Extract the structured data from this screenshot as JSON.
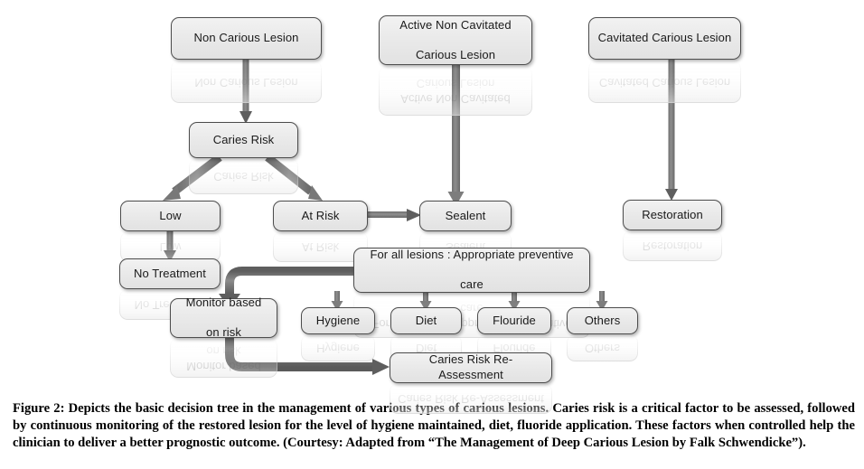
{
  "figure": {
    "caption": "Figure 2: Depicts the basic decision tree in the management of various types of carious lesions. Caries risk is a critical factor to be assessed, followed by continuous monitoring of the restored lesion for the level of hygiene maintained, diet, fluoride application. These factors when controlled help the clinician to deliver a better prognostic outcome. (Courtesy: Adapted from “The Management of Deep Carious Lesion by Falk Schwendicke”)."
  },
  "colors": {
    "box_fill_top": "#f2f2f2",
    "box_fill_bottom": "#e2e2e2",
    "box_border": "#4d4d4d",
    "text": "#1a1a1a",
    "arrow_dark": "#6b6b6b",
    "arrow_light": "#9a9a9a",
    "page_background": "#ffffff"
  },
  "nodes": {
    "non_carious_lesion": {
      "label": "Non Carious Lesion"
    },
    "active_non_cavitated": {
      "label": "Active Non Cavitated Carious Lesion",
      "line1": "Active Non Cavitated",
      "line2": "Carious Lesion"
    },
    "cavitated_carious": {
      "label": "Cavitated Carious Lesion"
    },
    "caries_risk": {
      "label": "Caries Risk"
    },
    "low": {
      "label": "Low"
    },
    "at_risk": {
      "label": "At Risk"
    },
    "sealent": {
      "label": "Sealent"
    },
    "restoration": {
      "label": "Restoration"
    },
    "no_treatment": {
      "label": "No Treatment"
    },
    "preventive_care": {
      "label": "For all lesions : Appropriate preventive care",
      "line1": "For all lesions : Appropriate preventive",
      "line2": "care"
    },
    "monitor_based_on_risk": {
      "label": "Monitor based on risk",
      "line1": "Monitor based",
      "line2": "on risk"
    },
    "hygiene": {
      "label": "Hygiene"
    },
    "diet": {
      "label": "Diet"
    },
    "flouride": {
      "label": "Flouride"
    },
    "others": {
      "label": "Others"
    },
    "caries_risk_reassessment": {
      "label": "Caries Risk Re-Assessment"
    }
  },
  "edges": [
    {
      "id": "e-noncarious-cariesrisk",
      "from": "non_carious_lesion",
      "to": "caries_risk",
      "style": "straight-down"
    },
    {
      "id": "e-cariesrisk-low",
      "from": "caries_risk",
      "to": "low",
      "style": "diagonal"
    },
    {
      "id": "e-cariesrisk-atrisk",
      "from": "caries_risk",
      "to": "at_risk",
      "style": "diagonal"
    },
    {
      "id": "e-atrisk-sealent",
      "from": "at_risk",
      "to": "sealent",
      "style": "straight-right"
    },
    {
      "id": "e-active-sealent",
      "from": "active_non_cavitated",
      "to": "sealent",
      "style": "straight-down"
    },
    {
      "id": "e-cavitated-restoration",
      "from": "cavitated_carious",
      "to": "restoration",
      "style": "straight-down"
    },
    {
      "id": "e-low-notreatment",
      "from": "low",
      "to": "no_treatment",
      "style": "straight-down"
    },
    {
      "id": "e-preventive-monitor",
      "from": "preventive_care",
      "to": "monitor_based_on_risk",
      "style": "elbow"
    },
    {
      "id": "e-monitor-reassessment",
      "from": "monitor_based_on_risk",
      "to": "caries_risk_reassessment",
      "style": "elbow"
    },
    {
      "id": "e-preventive-hygiene",
      "from": "preventive_care",
      "to": "hygiene",
      "style": "straight-down"
    },
    {
      "id": "e-preventive-diet",
      "from": "preventive_care",
      "to": "diet",
      "style": "straight-down"
    },
    {
      "id": "e-preventive-flouride",
      "from": "preventive_care",
      "to": "flouride",
      "style": "straight-down"
    },
    {
      "id": "e-preventive-others",
      "from": "preventive_care",
      "to": "others",
      "style": "straight-down"
    }
  ]
}
